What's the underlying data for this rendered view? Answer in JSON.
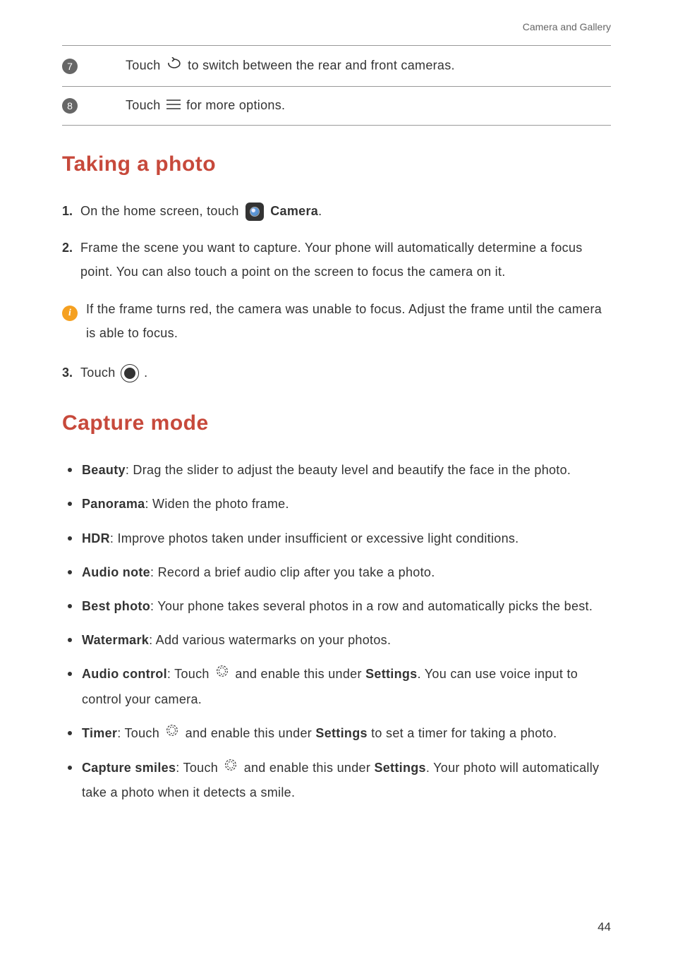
{
  "header": {
    "breadcrumb": "Camera and Gallery"
  },
  "table": {
    "row7": {
      "num": "7",
      "pre": "Touch ",
      "post": "to switch between the rear and front cameras."
    },
    "row8": {
      "num": "8",
      "pre": "Touch ",
      "post": "for more options."
    }
  },
  "section1": {
    "title": "Taking a photo",
    "step1": {
      "num": "1.",
      "pre": "On the home screen, touch ",
      "label": "Camera",
      "post": "."
    },
    "step2": {
      "num": "2.",
      "text": "Frame the scene you want to capture. Your phone will automatically determine a focus point. You can also touch a point on the screen to focus the camera on it."
    },
    "info": {
      "text": "If the frame turns red, the camera was unable to focus. Adjust the frame until the camera is able to focus."
    },
    "step3": {
      "num": "3.",
      "pre": "Touch ",
      "post": "."
    }
  },
  "section2": {
    "title": "Capture mode",
    "items": {
      "beauty": {
        "label": "Beauty",
        "text": ": Drag the slider to adjust the beauty level and beautify the face in the photo."
      },
      "panorama": {
        "label": "Panorama",
        "text": ": Widen the photo frame."
      },
      "hdr": {
        "label": "HDR",
        "text": ": Improve photos taken under insufficient or excessive light conditions."
      },
      "audionote": {
        "label": "Audio note",
        "text": ": Record a brief audio clip after you take a photo."
      },
      "bestphoto": {
        "label": "Best photo",
        "text": ": Your phone takes several photos in a row and automatically picks the best."
      },
      "watermark": {
        "label": "Watermark",
        "text": ": Add various watermarks on your photos."
      },
      "audiocontrol": {
        "label": "Audio control",
        "pre": ": Touch ",
        "mid": "and enable this under ",
        "settings": "Settings",
        "post": ". You can use voice input to control your camera."
      },
      "timer": {
        "label": "Timer",
        "pre": ": Touch ",
        "mid": "and enable this under ",
        "settings": "Settings",
        "post": " to set a timer for taking a photo."
      },
      "smiles": {
        "label": "Capture smiles",
        "pre": ": Touch ",
        "mid": "and enable this under ",
        "settings": "Settings",
        "post": ". Your photo will automatically take a photo when it detects a smile."
      }
    }
  },
  "page": "44"
}
